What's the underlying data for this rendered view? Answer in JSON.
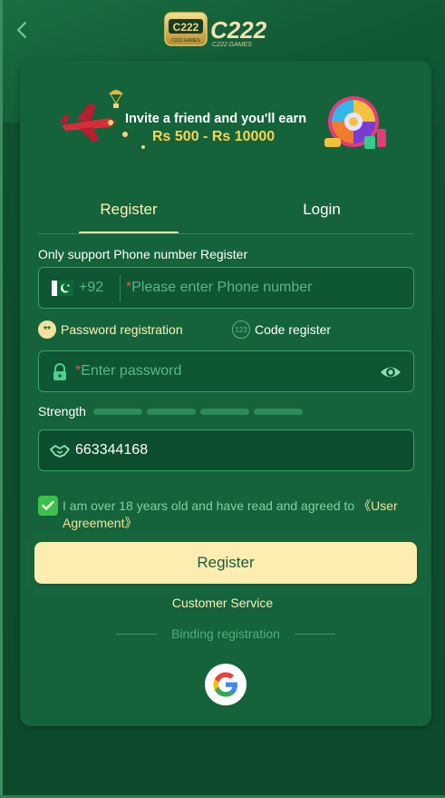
{
  "header": {
    "back_icon": "chevron-left-icon",
    "logo_alt": "C222 C222.GAMES",
    "logo_main": "C222",
    "logo_small": "C222.GAMES",
    "logo_badge": "C222",
    "logo_badge_sub": "C222.GAMES"
  },
  "banner": {
    "line1": "Invite a friend and you'll earn",
    "line2": "Rs 500 - Rs 10000"
  },
  "tabs": [
    {
      "label": "Register",
      "active": true
    },
    {
      "label": "Login",
      "active": false
    }
  ],
  "form": {
    "note": "Only support Phone number Register",
    "phone": {
      "country_code": "+92",
      "required_mark": "*",
      "placeholder": "Please enter Phone number",
      "value": ""
    },
    "modes": [
      {
        "label": "Password registration",
        "icon": "**",
        "selected": true
      },
      {
        "label": "Code register",
        "icon": "123",
        "selected": false
      }
    ],
    "password": {
      "required_mark": "*",
      "placeholder": "Enter password",
      "value": ""
    },
    "strength_label": "Strength",
    "strength_level": 0,
    "invite_code": {
      "value": "663344168"
    },
    "agreement": {
      "text": "I am over 18 years old and have read and agreed to ",
      "link": "《User Agreement》",
      "checked": true
    },
    "submit_label": "Register"
  },
  "footer": {
    "customer_service": "Customer Service",
    "binding_label": "Binding registration",
    "provider_icon": "google-icon"
  },
  "colors": {
    "accent": "#fdedb0",
    "card": "#14633a",
    "check": "#3bc04a",
    "link": "#f6e29a"
  }
}
